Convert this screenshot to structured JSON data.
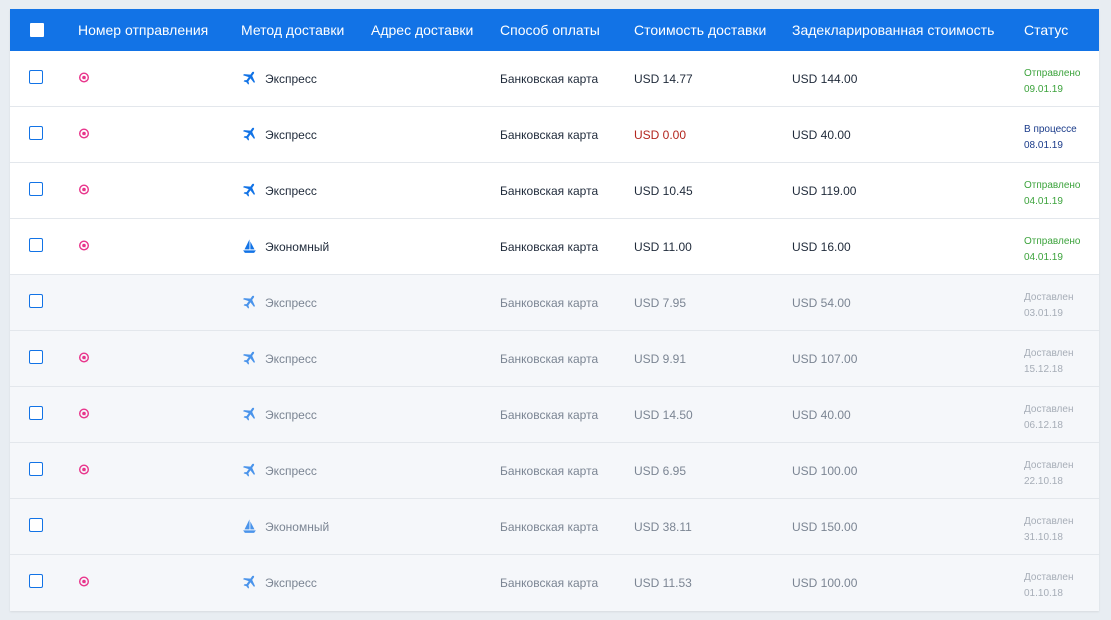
{
  "header": {
    "columns": [
      "Номер отправления",
      "Метод доставки",
      "Адрес доставки",
      "Способ оплаты",
      "Стоимость доставки",
      "Задекларированная стоимость",
      "Статус"
    ]
  },
  "colors": {
    "header_bg": "#1273e6",
    "sent": "#3ca33c",
    "processing": "#1a3b8a",
    "delivered": "#a6adb7",
    "zero_cost": "#b3261e",
    "track_icon": "#e8348b"
  },
  "icons": {
    "express": "airplane-icon",
    "economy": "sailboat-icon",
    "tracking": "tracking-pin-icon"
  },
  "rows": [
    {
      "track": true,
      "method": "Экспресс",
      "method_type": "express",
      "payment": "Банковская карта",
      "cost": "USD 14.77",
      "declared": "USD 144.00",
      "status": "Отправлено",
      "date": "09.01.19",
      "state": "sent"
    },
    {
      "track": true,
      "method": "Экспресс",
      "method_type": "express",
      "payment": "Банковская карта",
      "cost": "USD 0.00",
      "declared": "USD 40.00",
      "status": "В процессе",
      "date": "08.01.19",
      "state": "proc"
    },
    {
      "track": true,
      "method": "Экспресс",
      "method_type": "express",
      "payment": "Банковская карта",
      "cost": "USD 10.45",
      "declared": "USD 119.00",
      "status": "Отправлено",
      "date": "04.01.19",
      "state": "sent"
    },
    {
      "track": true,
      "method": "Экономный",
      "method_type": "economy",
      "payment": "Банковская карта",
      "cost": "USD 11.00",
      "declared": "USD 16.00",
      "status": "Отправлено",
      "date": "04.01.19",
      "state": "sent"
    },
    {
      "track": false,
      "method": "Экспресс",
      "method_type": "express",
      "payment": "Банковская карта",
      "cost": "USD 7.95",
      "declared": "USD 54.00",
      "status": "Доставлен",
      "date": "03.01.19",
      "state": "done"
    },
    {
      "track": true,
      "method": "Экспресс",
      "method_type": "express",
      "payment": "Банковская карта",
      "cost": "USD 9.91",
      "declared": "USD 107.00",
      "status": "Доставлен",
      "date": "15.12.18",
      "state": "done"
    },
    {
      "track": true,
      "method": "Экспресс",
      "method_type": "express",
      "payment": "Банковская карта",
      "cost": "USD 14.50",
      "declared": "USD 40.00",
      "status": "Доставлен",
      "date": "06.12.18",
      "state": "done"
    },
    {
      "track": true,
      "method": "Экспресс",
      "method_type": "express",
      "payment": "Банковская карта",
      "cost": "USD 6.95",
      "declared": "USD 100.00",
      "status": "Доставлен",
      "date": "22.10.18",
      "state": "done"
    },
    {
      "track": false,
      "method": "Экономный",
      "method_type": "economy",
      "payment": "Банковская карта",
      "cost": "USD 38.11",
      "declared": "USD 150.00",
      "status": "Доставлен",
      "date": "31.10.18",
      "state": "done"
    },
    {
      "track": true,
      "method": "Экспресс",
      "method_type": "express",
      "payment": "Банковская карта",
      "cost": "USD 11.53",
      "declared": "USD 100.00",
      "status": "Доставлен",
      "date": "01.10.18",
      "state": "done"
    }
  ]
}
